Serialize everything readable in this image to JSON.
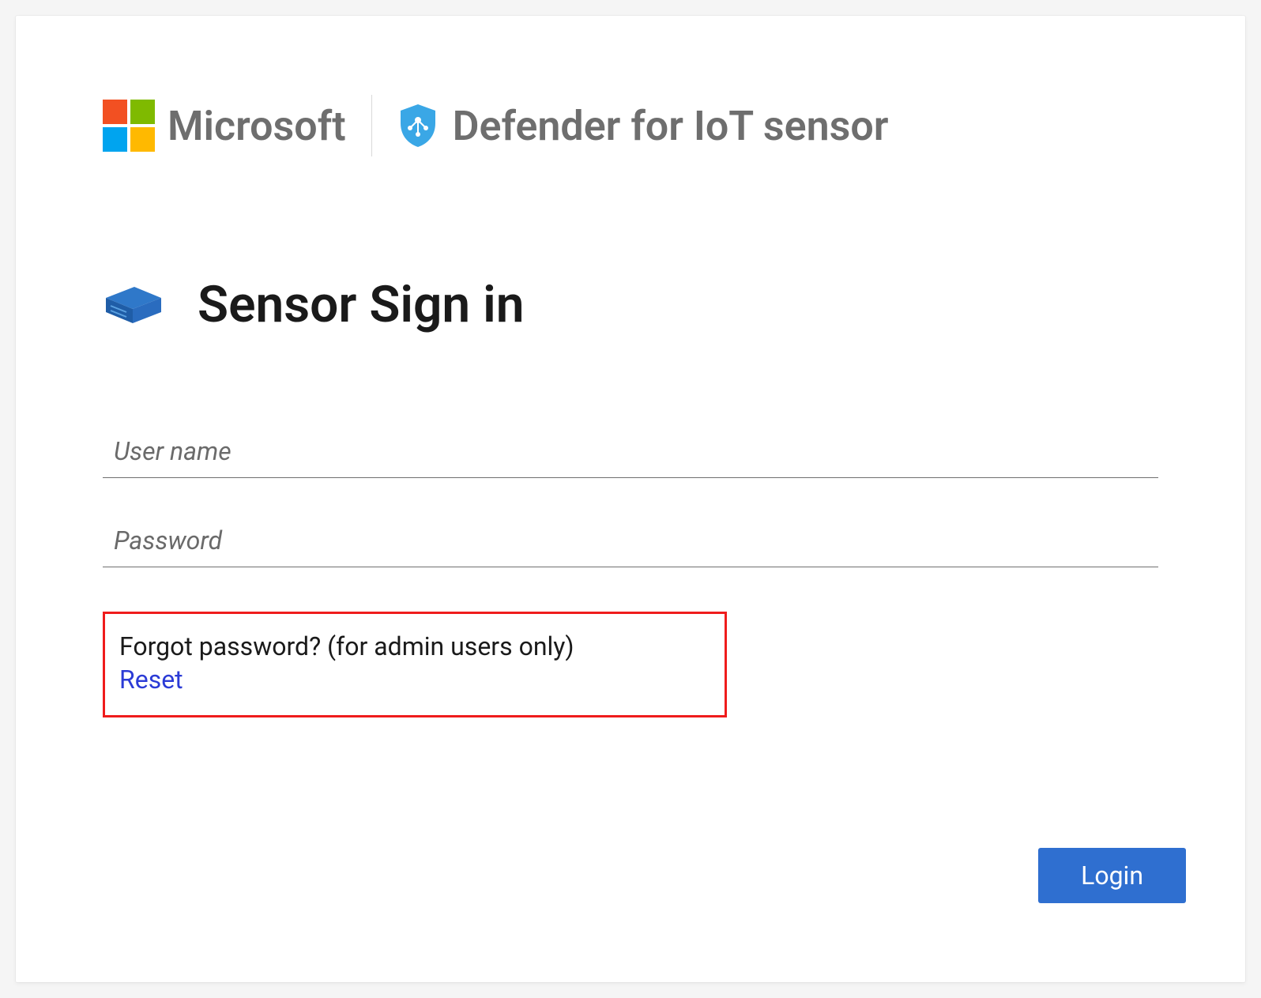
{
  "header": {
    "brand": "Microsoft",
    "product_name": "Defender for IoT sensor"
  },
  "title": "Sensor Sign in",
  "form": {
    "username": {
      "placeholder": "User name",
      "value": ""
    },
    "password": {
      "placeholder": "Password",
      "value": ""
    }
  },
  "forgot": {
    "prompt": "Forgot password? (for admin users only)",
    "reset_label": "Reset"
  },
  "actions": {
    "login_label": "Login"
  },
  "colors": {
    "accent": "#2f6fd0",
    "link": "#2b3bd6",
    "highlight_border": "#ef1c1c"
  }
}
